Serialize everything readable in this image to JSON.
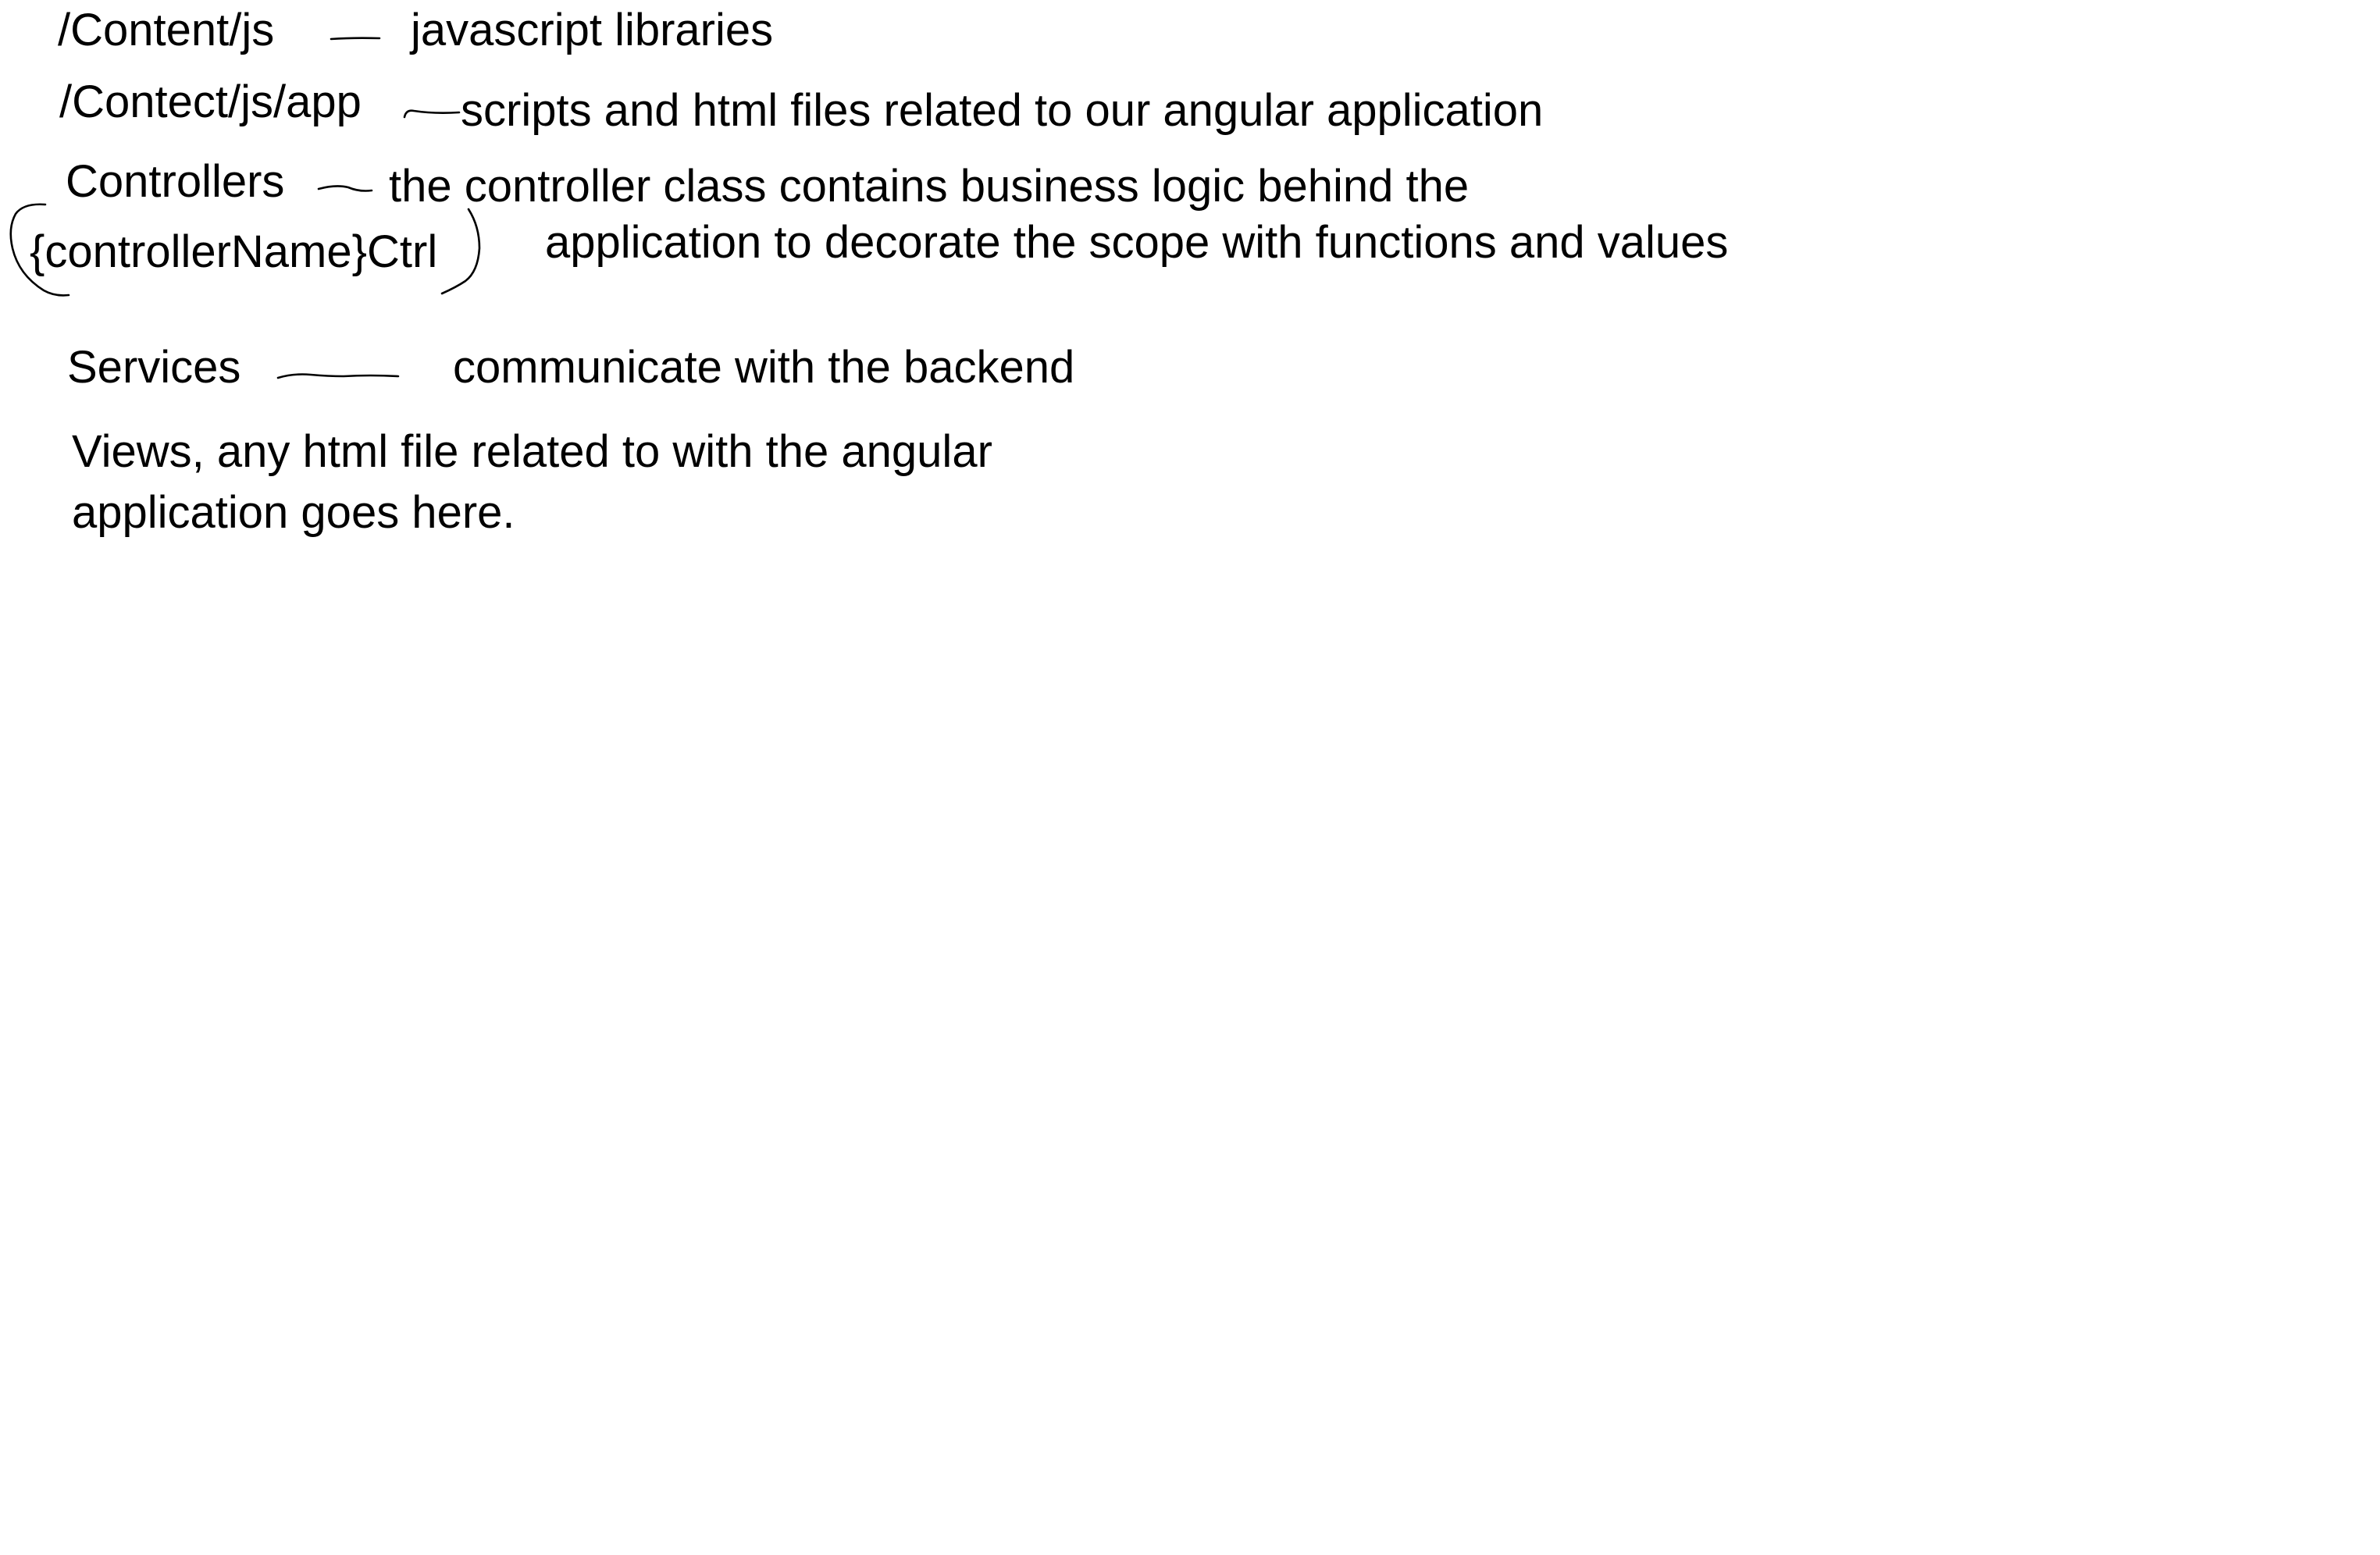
{
  "notes": {
    "content_js": {
      "term": "/Content/js",
      "description": "javascript libraries"
    },
    "content_js_app": {
      "term": "/Contect/js/app",
      "description": "scripts and html files related to our angular application"
    },
    "controllers": {
      "term": "Controllers",
      "naming": "{controllerName}Ctrl",
      "description_line1": "the controller class contains business logic behind the",
      "description_line2": "application to decorate the scope with functions and values"
    },
    "services": {
      "term": "Services",
      "description": "communicate with the backend"
    },
    "views": {
      "line1": "Views, any html file related to with the angular",
      "line2": "application goes here."
    }
  }
}
